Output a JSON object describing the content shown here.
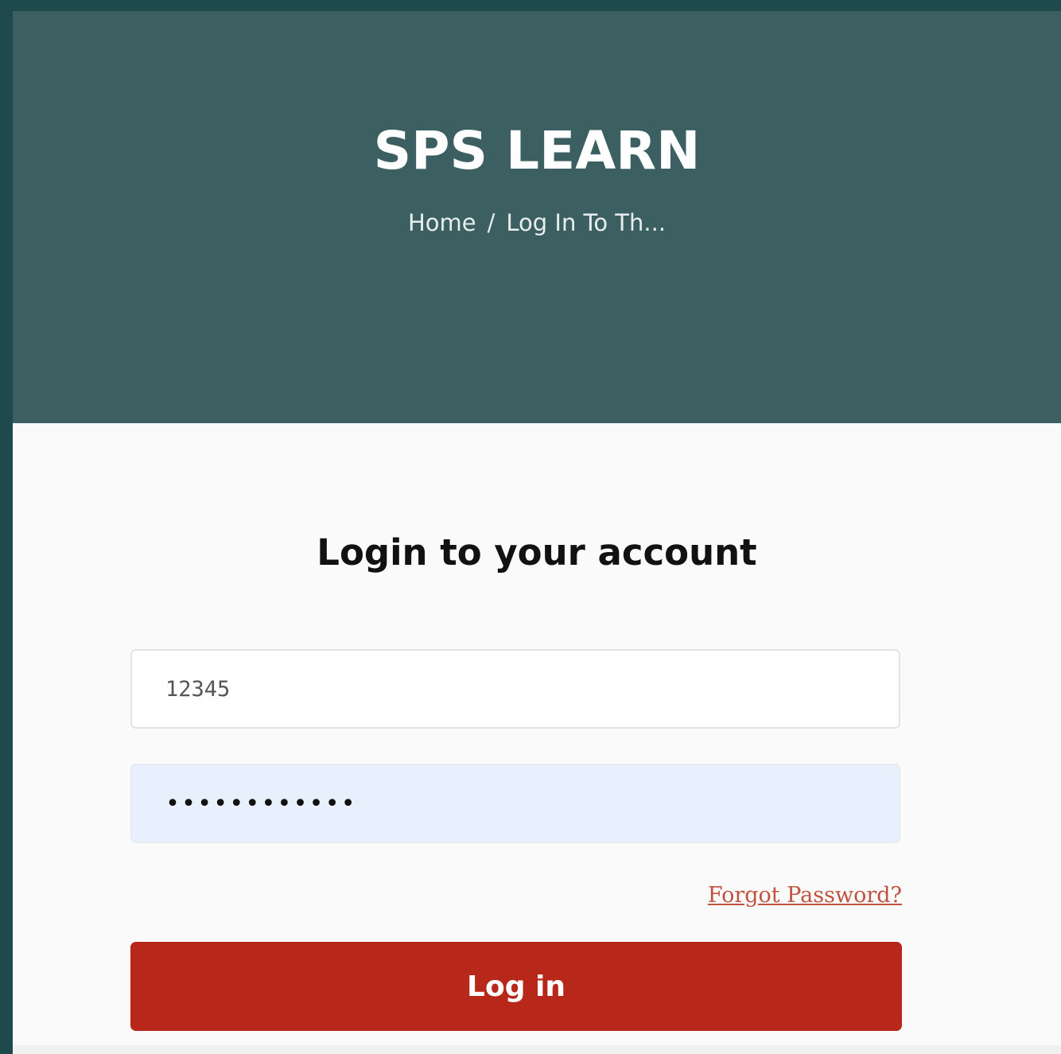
{
  "header": {
    "brand": "SPS LEARN",
    "breadcrumb": {
      "home": "Home",
      "separator": "/",
      "current": "Log In To Th..."
    }
  },
  "login": {
    "title": "Login to your account",
    "username_value": "12345",
    "password_masked": "••••••••••••",
    "forgot_label": "Forgot Password?",
    "submit_label": "Log in"
  },
  "colors": {
    "outer_frame": "#1e4a4e",
    "hero_bg": "#3c6062",
    "button_bg": "#b7281b",
    "link": "#c0533f",
    "autofill_bg": "#e8f0fe"
  }
}
